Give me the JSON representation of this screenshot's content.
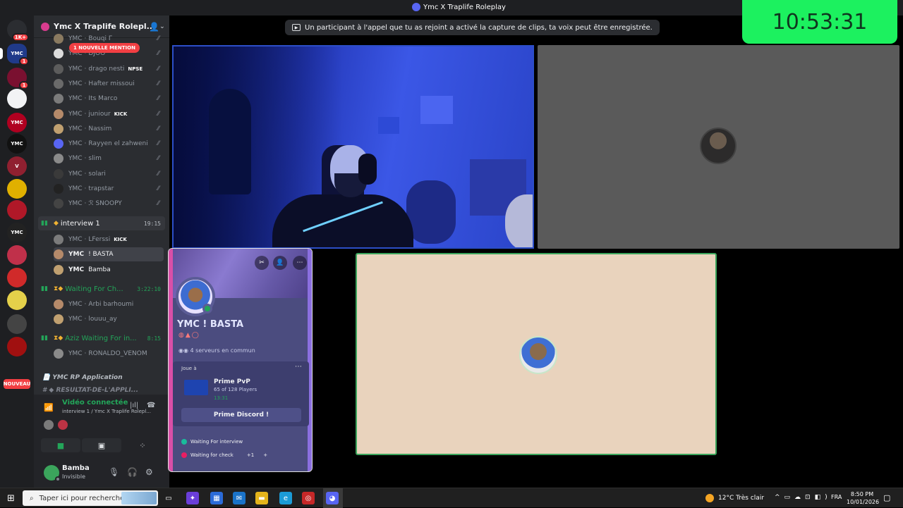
{
  "window": {
    "title": "Ymc X Traplife Roleplay"
  },
  "rail": {
    "servers": [
      {
        "label": "",
        "badge": "1K+",
        "color": "#2b2d31"
      },
      {
        "label": "YMC",
        "badge": "1",
        "color": "#203a8a"
      },
      {
        "label": "",
        "badge": "1",
        "color": "#7a1030"
      },
      {
        "label": "",
        "badge": "",
        "color": "#f2f3f5"
      },
      {
        "label": "YMC",
        "badge": "",
        "color": "#b00020"
      },
      {
        "label": "YMC",
        "badge": "",
        "color": "#111"
      },
      {
        "label": "V",
        "badge": "",
        "color": "#902030"
      },
      {
        "label": "",
        "badge": "",
        "color": "#e0b000"
      },
      {
        "label": "",
        "badge": "",
        "color": "#b01828"
      },
      {
        "label": "YMC",
        "badge": "",
        "color": "#222"
      },
      {
        "label": "",
        "badge": "",
        "color": "#c0304a"
      },
      {
        "label": "",
        "badge": "",
        "color": "#d02a2a"
      },
      {
        "label": "",
        "badge": "",
        "color": "#e4d04a"
      },
      {
        "label": "",
        "badge": "",
        "color": "#444"
      },
      {
        "label": "",
        "badge": "",
        "color": "#a01010"
      }
    ],
    "nouveau_label": "NOUVEAU"
  },
  "sidebar": {
    "guild_name": "Ymc X Traplife Rolepl...",
    "mention_banner": "1 NOUVELLE MENTION",
    "members_top": [
      {
        "tag": "YMC",
        "name": "Bouqi Γ",
        "extra": ""
      },
      {
        "tag": "YMC",
        "name": "DJOO",
        "extra": ""
      },
      {
        "tag": "YMC",
        "name": "drago nesti",
        "extra": "NPSE"
      },
      {
        "tag": "YMC",
        "name": "Hafter missoui",
        "extra": ""
      },
      {
        "tag": "YMC",
        "name": "Its Marco",
        "extra": ""
      },
      {
        "tag": "YMC",
        "name": "juniour",
        "extra": "KICK"
      },
      {
        "tag": "YMC",
        "name": "Nassim",
        "extra": ""
      },
      {
        "tag": "YMC",
        "name": "Rayyen el zahweni",
        "extra": ""
      },
      {
        "tag": "YMC",
        "name": "slim",
        "extra": ""
      },
      {
        "tag": "YMC",
        "name": "solari",
        "extra": ""
      },
      {
        "tag": "YMC",
        "name": "trapstar",
        "extra": ""
      },
      {
        "tag": "YMC",
        "name": "ℛ SNOOPY",
        "extra": ""
      }
    ],
    "channel_interview": {
      "name": "interview 1",
      "time": "19:15"
    },
    "interview_members": [
      {
        "tag": "YMC",
        "name": "LFerssi",
        "extra": "KICK"
      },
      {
        "tag": "YMC",
        "name": "! BASTA",
        "extra": ""
      },
      {
        "tag": "YMC",
        "name": "Bamba",
        "extra": ""
      }
    ],
    "channel_waiting": {
      "name": "Waiting For Ch...",
      "time": "3:22:10"
    },
    "waiting_members": [
      {
        "tag": "YMC",
        "name": "Arbi barhoumi",
        "extra": ""
      },
      {
        "tag": "YMC",
        "name": "louuu_ay",
        "extra": ""
      }
    ],
    "channel_aziz": {
      "name": "Aziz Waiting For in...",
      "time": "8:15"
    },
    "aziz_members": [
      {
        "tag": "YMC",
        "name": "RONALDO_VENOM",
        "extra": ""
      }
    ],
    "category": "YMC RP Application",
    "channel_result": "RESULTAT-DE-L'APPLI..."
  },
  "voice": {
    "status": "Vidéo connectée",
    "location": "interview 1 / Ymc X Traplife Rolepl..."
  },
  "user": {
    "name": "Bamba",
    "status": "Invisible"
  },
  "notice": {
    "text": "Un participant à l'appel que tu as rejoint a activé la capture de clips, ta voix peut être enregistrée."
  },
  "clock": {
    "time": "10:53:31"
  },
  "profile": {
    "name": "YMC ! BASTA",
    "servers": "4 serveurs en commun",
    "playing_label": "Joue à",
    "game_name": "Prime PvP",
    "game_players": "65 of 128 Players",
    "game_time": "13:31",
    "button": "Prime Discord !",
    "roles": [
      {
        "name": "Waiting For interview",
        "color": "#1abc9c"
      },
      {
        "name": "Waiting for check",
        "color": "#e91e63"
      }
    ],
    "roles_more": "+1"
  },
  "taskbar": {
    "search_placeholder": "Taper ici pour rechercher",
    "weather": "12°C  Très clair",
    "lang": "FRA",
    "time": "8:50 PM",
    "date": "10/01/2026"
  }
}
